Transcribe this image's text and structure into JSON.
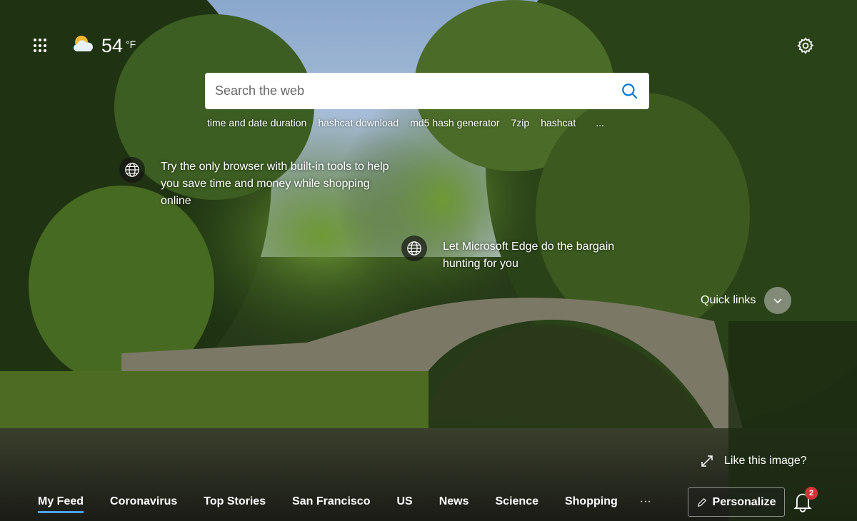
{
  "weather": {
    "temperature": "54",
    "unit": "°F",
    "icon": "partly-cloudy-icon"
  },
  "search": {
    "placeholder": "Search the web"
  },
  "suggestions": [
    "time and date duration",
    "hashcat download",
    "md5 hash generator",
    "7zip",
    "hashcat",
    "..."
  ],
  "promos": [
    {
      "text": "Try the only browser with built-in tools to help you save time and money while shopping online"
    },
    {
      "text": "Let Microsoft Edge do the bargain hunting for you"
    }
  ],
  "quick_links": {
    "label": "Quick links"
  },
  "image": {
    "like_label": "Like this image?"
  },
  "nav": {
    "items": [
      "My Feed",
      "Coronavirus",
      "Top Stories",
      "San Francisco",
      "US",
      "News",
      "Science",
      "Shopping"
    ],
    "more": "···",
    "active": "My Feed"
  },
  "personalize": {
    "label": "Personalize"
  },
  "notifications": {
    "count": "2",
    "badge_color": "#d13438"
  },
  "colors": {
    "accent": "#4aa3f0",
    "search_icon": "#0078d4"
  }
}
